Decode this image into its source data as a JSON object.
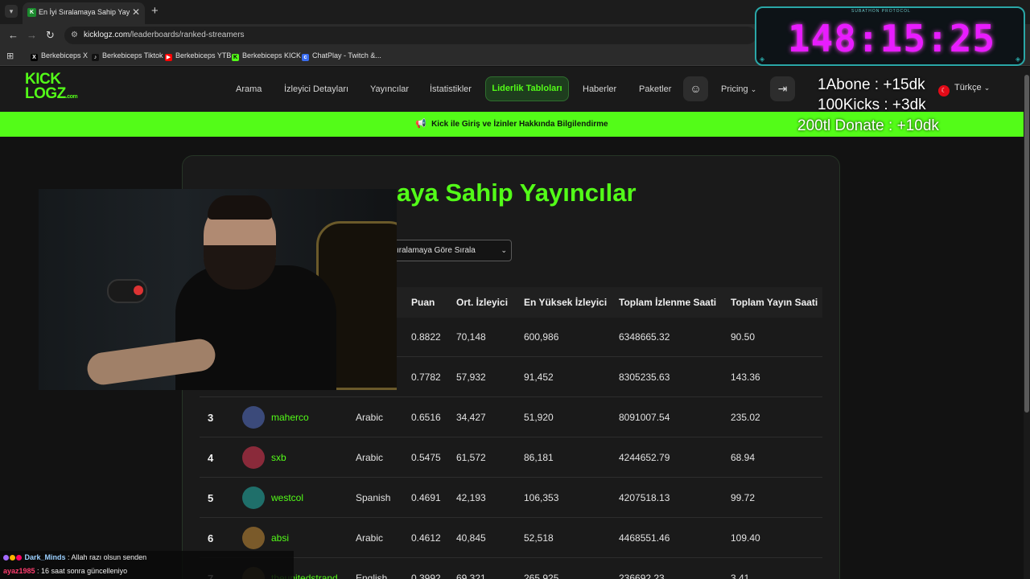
{
  "browser": {
    "tab_title": "En İyi Sıralamaya Sahip Yayıncıla",
    "tab_close": "✕",
    "new_tab": "+",
    "url_domain": "kicklogz.com",
    "url_path": "/leaderboards/ranked-streamers",
    "bookmarks": [
      {
        "label": "Berkebiceps X",
        "icon": "x-icon",
        "color": "#000000",
        "glyph": "X"
      },
      {
        "label": "Berkebiceps Tiktok",
        "icon": "tiktok-icon",
        "color": "#111111",
        "glyph": "♪"
      },
      {
        "label": "Berkebiceps YTB",
        "icon": "youtube-icon",
        "color": "#ff0000",
        "glyph": "▶"
      },
      {
        "label": "Berkebiceps KICK",
        "icon": "kick-icon",
        "color": "#53fc18",
        "glyph": "K"
      },
      {
        "label": "ChatPlay - Twitch &...",
        "icon": "chatplay-icon",
        "color": "#3a6df0",
        "glyph": "c"
      }
    ]
  },
  "site": {
    "logo_line1": "KICK",
    "logo_line2": "LOGZ",
    "logo_suffix": ".com",
    "nav": {
      "search": "Arama",
      "viewer_details": "İzleyici Detayları",
      "streamers": "Yayıncılar",
      "statistics": "İstatistikler",
      "leaderboards": "Liderlik Tabloları",
      "news": "Haberler",
      "packages": "Paketler",
      "pricing": "Pricing",
      "language": "Türkçe"
    },
    "announcement": "Kick ile Giriş ve İzinler Hakkında Bilgilendirme"
  },
  "page": {
    "title_visible": "aya Sahip Yayıncılar",
    "sort_select_value": "ıralamaya Göre Sırala",
    "columns": {
      "score": "Puan",
      "avg_viewers": "Ort. İzleyici",
      "peak_viewers": "En Yüksek İzleyici",
      "total_watch_hours": "Toplam İzlenme Saati",
      "total_stream_hours": "Toplam Yayın Saati"
    },
    "rows": [
      {
        "rank": "",
        "name": "",
        "language": "",
        "score": "0.8822",
        "avg": "70,148",
        "peak": "600,986",
        "watch": "6348665.32",
        "stream": "90.50",
        "avatar_color": "#222"
      },
      {
        "rank": "",
        "name": "",
        "language": "",
        "score": "0.7782",
        "avg": "57,932",
        "peak": "91,452",
        "watch": "8305235.63",
        "stream": "143.36",
        "avatar_color": "#222"
      },
      {
        "rank": "3",
        "name": "maherco",
        "language": "Arabic",
        "score": "0.6516",
        "avg": "34,427",
        "peak": "51,920",
        "watch": "8091007.54",
        "stream": "235.02",
        "avatar_color": "#3b4a7a"
      },
      {
        "rank": "4",
        "name": "sxb",
        "language": "Arabic",
        "score": "0.5475",
        "avg": "61,572",
        "peak": "86,181",
        "watch": "4244652.79",
        "stream": "68.94",
        "avatar_color": "#8a2a3a"
      },
      {
        "rank": "5",
        "name": "westcol",
        "language": "Spanish",
        "score": "0.4691",
        "avg": "42,193",
        "peak": "106,353",
        "watch": "4207518.13",
        "stream": "99.72",
        "avatar_color": "#1f6f6a"
      },
      {
        "rank": "6",
        "name": "absi",
        "language": "Arabic",
        "score": "0.4612",
        "avg": "40,845",
        "peak": "52,518",
        "watch": "4468551.46",
        "stream": "109.40",
        "avatar_color": "#7a5a2a"
      },
      {
        "rank": "7",
        "name": "theunitedstrand",
        "language": "English",
        "score": "0.3992",
        "avg": "69,321",
        "peak": "265,925",
        "watch": "236692.23",
        "stream": "3.41",
        "avatar_color": "#5a4a2a"
      }
    ]
  },
  "overlay": {
    "timer_header": "SUBATHON PROTOCOL",
    "timer_value": "148:15:25",
    "rule_sub": "1Abone : +15dk",
    "rule_kicks": "100Kicks : +3dk",
    "rule_donate": "200tl Donate : +10dk",
    "chat": [
      {
        "user": "Dark_Minds",
        "message": " : Allah razı olsun senden"
      },
      {
        "user": "ayaz1985",
        "message": " : 16 saat sonra güncelleniyo"
      }
    ]
  },
  "colors": {
    "accent": "#53fc18",
    "timer": "#e81cff"
  }
}
